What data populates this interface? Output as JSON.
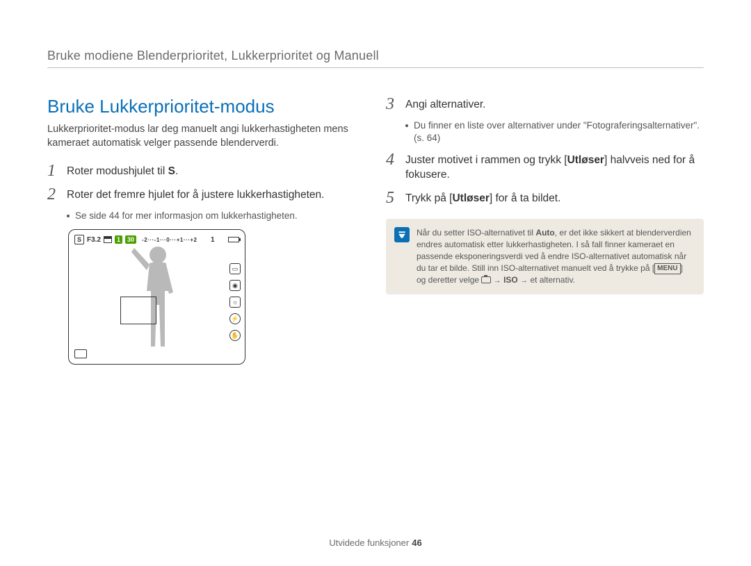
{
  "running_head": "Bruke modiene Blenderprioritet, Lukkerprioritet og Manuell",
  "section_title": "Bruke Lukkerprioritet-modus",
  "intro": "Lukkerprioritet-modus lar deg manuelt angi lukkerhastigheten mens kameraet automatisk velger passende blenderverdi.",
  "steps": {
    "1": {
      "pre": "Roter modushjulet til ",
      "mode": "S",
      "post": "."
    },
    "2": "Roter det fremre hjulet for å justere lukkerhastigheten.",
    "2_sub": "Se side 44 for mer informasjon om lukkerhastigheten.",
    "3": "Angi alternativer.",
    "3_sub": "Du finner en liste over alternativer under \"Fotograferingsalternativer\". (s. 64)",
    "4_pre": "Juster motivet i rammen og trykk [",
    "4_btn": "Utløser",
    "4_post": "] halvveis ned for å fokusere.",
    "5_pre": "Trykk på [",
    "5_btn": "Utløser",
    "5_post": "] for å ta bildet."
  },
  "lcd": {
    "aperture": "F3.2",
    "shutter_badge_a": "1",
    "shutter_badge_b": "30",
    "ev": "-2···-1···0···+1···+2",
    "counter": "1"
  },
  "note": {
    "t1": "Når du setter ISO-alternativet til ",
    "auto": "Auto",
    "t2": ", er det ikke sikkert at blenderverdien endres automatisk etter lukkerhastigheten. I så fall finner kameraet en passende eksponeringsverdi ved å endre ISO-alternativet automatisk når du tar et bilde. Still inn ISO-alternativet manuelt ved å trykke på [",
    "menu": "MENU",
    "t3": "] og deretter velge ",
    "iso": "ISO",
    "t4": " et alternativ."
  },
  "footer": {
    "label": "Utvidede funksjoner",
    "page": "46"
  }
}
